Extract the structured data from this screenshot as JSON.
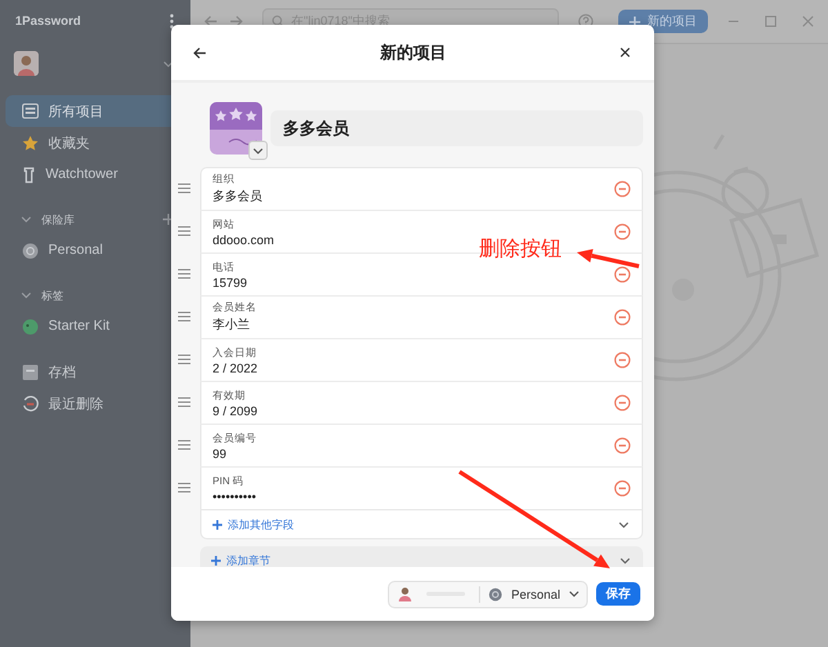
{
  "app": {
    "title": "1Password"
  },
  "sidebar": {
    "items": [
      {
        "kind": "item",
        "label": "所有项目",
        "selected": true
      },
      {
        "kind": "item",
        "label": "收藏夹",
        "selected": false
      },
      {
        "kind": "item",
        "label": "Watchtower",
        "selected": false
      },
      {
        "kind": "section",
        "label": "保险库",
        "expanded": true
      },
      {
        "kind": "item",
        "label": "Personal",
        "selected": false
      },
      {
        "kind": "section",
        "label": "标签",
        "expanded": true
      },
      {
        "kind": "item",
        "label": "Starter Kit",
        "selected": false
      },
      {
        "kind": "gap"
      },
      {
        "kind": "item",
        "label": "存档",
        "selected": false
      },
      {
        "kind": "item",
        "label": "最近删除",
        "selected": false
      }
    ]
  },
  "toolbar": {
    "search": {
      "placeholder": "在\"lin0718\"中搜索"
    },
    "new_button": "新的项目"
  },
  "dialog": {
    "title": "新的项目",
    "name": "多多会员",
    "fields": [
      {
        "label": "组织",
        "value": "多多会员"
      },
      {
        "label": "网站",
        "value": "ddooo.com"
      },
      {
        "label": "电话",
        "value": "15799"
      },
      {
        "label": "会员姓名",
        "value": "李小兰"
      },
      {
        "label": "入会日期",
        "value": "2 / 2022"
      },
      {
        "label": "有效期",
        "value": "9 / 2099"
      },
      {
        "label": "会员编号",
        "value": "99"
      },
      {
        "label": "PIN 码",
        "value": "••••••••••"
      }
    ],
    "add_field": "添加其他字段",
    "add_section": "添加章节",
    "vault": "Personal",
    "save": "保存"
  },
  "annotations": [
    {
      "kind": "callout",
      "text": "删除按钮"
    },
    {
      "kind": "arrow"
    },
    {
      "kind": "arrow"
    }
  ]
}
